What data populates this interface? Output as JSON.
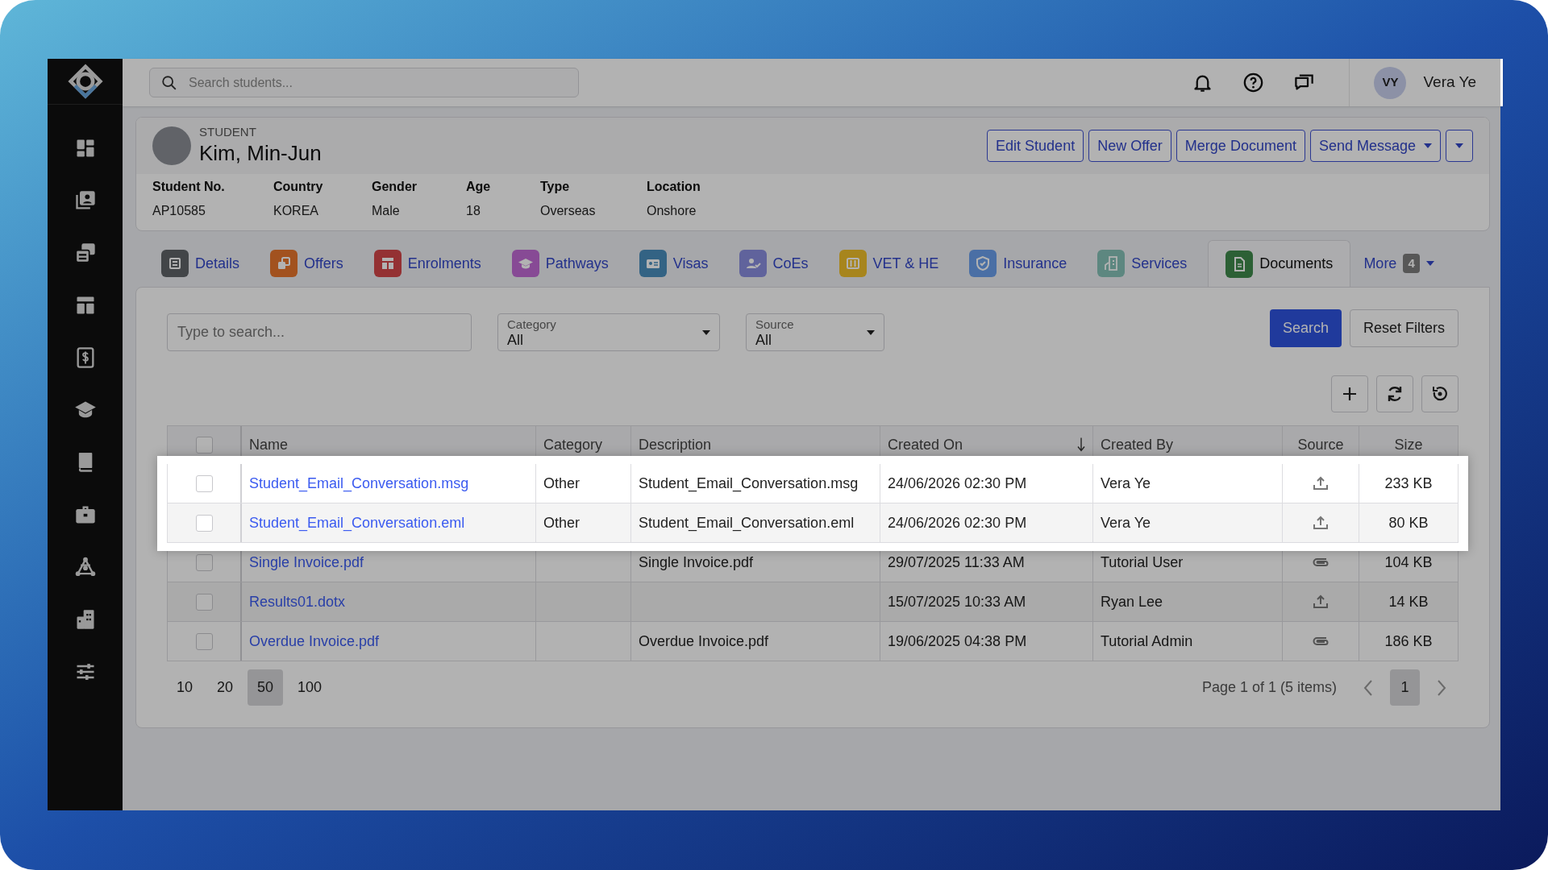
{
  "search": {
    "placeholder": "Search students..."
  },
  "user": {
    "initials": "VY",
    "name": "Vera Ye"
  },
  "student": {
    "label": "STUDENT",
    "name": "Kim, Min-Jun",
    "fields": [
      {
        "label": "Student No.",
        "value": "AP10585"
      },
      {
        "label": "Country",
        "value": "KOREA"
      },
      {
        "label": "Gender",
        "value": "Male"
      },
      {
        "label": "Age",
        "value": "18"
      },
      {
        "label": "Type",
        "value": "Overseas"
      },
      {
        "label": "Location",
        "value": "Onshore"
      }
    ]
  },
  "actions": [
    {
      "kind": "button",
      "label": "Edit Student"
    },
    {
      "kind": "button",
      "label": "New Offer"
    },
    {
      "kind": "button",
      "label": "Merge Document"
    },
    {
      "kind": "dropdown",
      "label": "Send Message"
    },
    {
      "kind": "caret"
    }
  ],
  "tabs": [
    {
      "label": "Details",
      "selected": false
    },
    {
      "label": "Offers",
      "selected": false
    },
    {
      "label": "Enrolments",
      "selected": false
    },
    {
      "label": "Pathways",
      "selected": false
    },
    {
      "label": "Visas",
      "selected": false
    },
    {
      "label": "CoEs",
      "selected": false
    },
    {
      "label": "VET & HE",
      "selected": false
    },
    {
      "label": "Insurance",
      "selected": false
    },
    {
      "label": "Services",
      "selected": false
    },
    {
      "label": "Documents",
      "selected": true
    }
  ],
  "more_tab": {
    "label": "More",
    "badge": "4"
  },
  "filters": {
    "search_placeholder": "Type to search...",
    "selects": [
      {
        "label": "Category",
        "value": "All"
      },
      {
        "label": "Source",
        "value": "All"
      }
    ],
    "buttons": [
      {
        "label": "Search",
        "kind": "primary"
      },
      {
        "label": "Reset Filters",
        "kind": "secondary"
      }
    ]
  },
  "table": {
    "header_checked": false,
    "columns": [
      {
        "label": "Name",
        "sorted": false
      },
      {
        "label": "Category",
        "sorted": false
      },
      {
        "label": "Description",
        "sorted": false
      },
      {
        "label": "Created On",
        "sorted": true
      },
      {
        "label": "Created By",
        "sorted": false
      },
      {
        "label": "Source",
        "sorted": false
      },
      {
        "label": "Size",
        "sorted": false
      }
    ],
    "rows": [
      {
        "name": "Student_Email_Conversation.msg",
        "category": "Other",
        "description": "Student_Email_Conversation.msg",
        "created_on": "24/06/2026 02:30 PM",
        "created_by": "Vera Ye",
        "kind": "upload",
        "size": "233 KB",
        "checked": false,
        "highlighted": true
      },
      {
        "name": "Student_Email_Conversation.eml",
        "category": "Other",
        "description": "Student_Email_Conversation.eml",
        "created_on": "24/06/2026 02:30 PM",
        "created_by": "Vera Ye",
        "kind": "upload",
        "size": "80 KB",
        "checked": false,
        "highlighted": true
      },
      {
        "name": "Single Invoice.pdf",
        "description": "Single Invoice.pdf",
        "created_on": "29/07/2025 11:33 AM",
        "created_by": "Tutorial User",
        "kind": "attachment",
        "size": "104 KB",
        "checked": false,
        "highlighted": false
      },
      {
        "name": "Results01.dotx",
        "created_on": "15/07/2025 10:33 AM",
        "created_by": "Ryan Lee",
        "kind": "upload",
        "size": "14 KB",
        "checked": false,
        "highlighted": false
      },
      {
        "name": "Overdue Invoice.pdf",
        "description": "Overdue Invoice.pdf",
        "created_on": "19/06/2025 04:38 PM",
        "created_by": "Tutorial Admin",
        "kind": "attachment",
        "size": "186 KB",
        "checked": false,
        "highlighted": false
      }
    ]
  },
  "pagination": {
    "page_sizes": [
      {
        "label": "10",
        "selected": false
      },
      {
        "label": "20",
        "selected": false
      },
      {
        "label": "50",
        "selected": true
      },
      {
        "label": "100",
        "selected": false
      }
    ],
    "summary": "Page 1 of 1 (5 items)",
    "pages": [
      {
        "label": "1",
        "selected": true
      }
    ]
  }
}
